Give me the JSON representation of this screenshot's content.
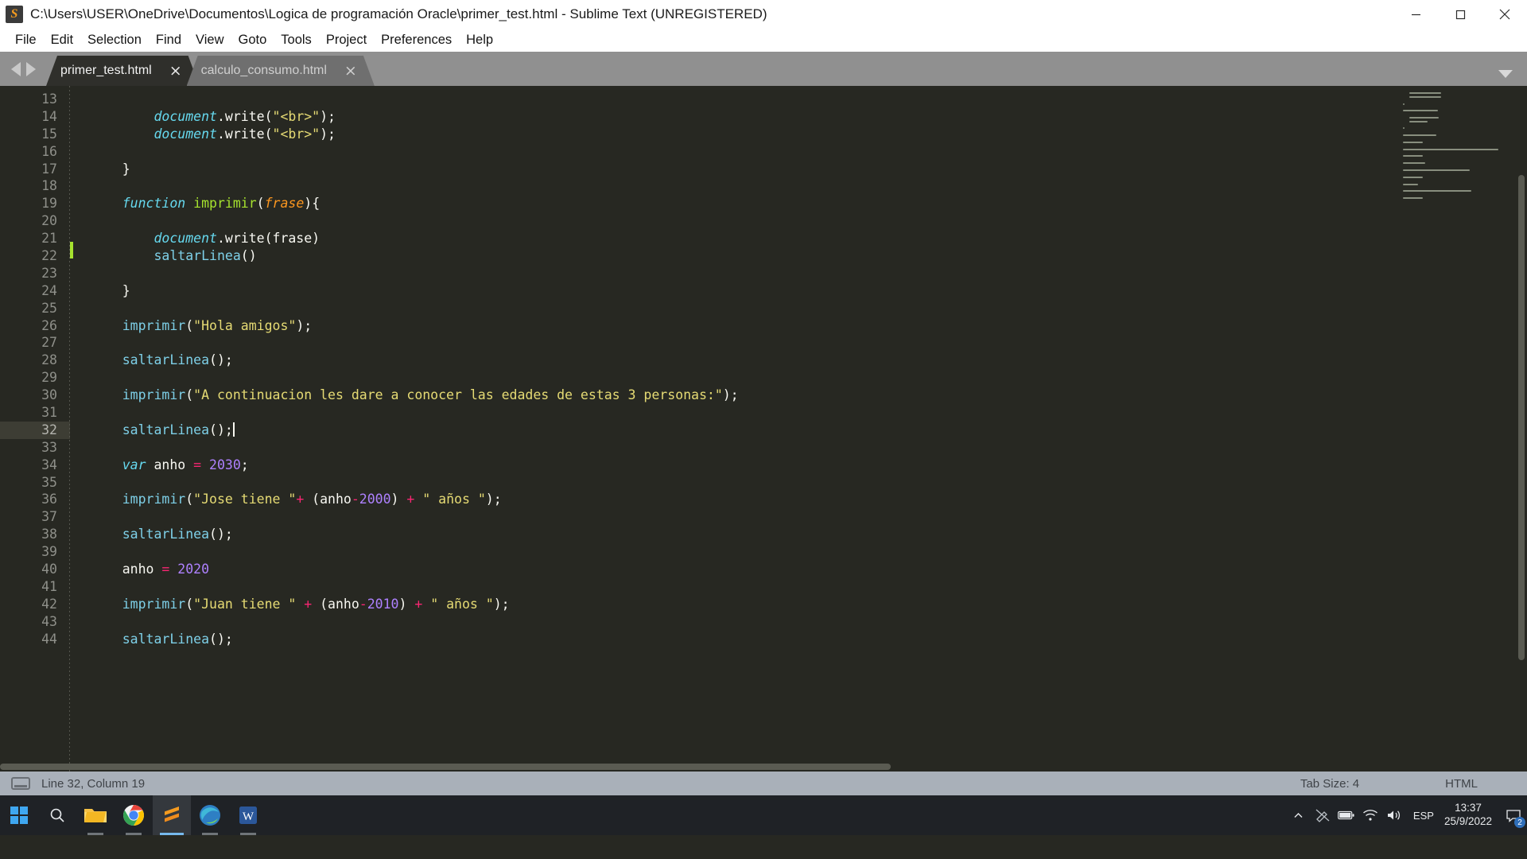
{
  "window": {
    "title": "C:\\Users\\USER\\OneDrive\\Documentos\\Logica de programación Oracle\\primer_test.html - Sublime Text (UNREGISTERED)",
    "app_icon": "sublime-text-icon",
    "controls": {
      "minimize": "minimize-icon",
      "maximize": "maximize-icon",
      "close": "close-icon"
    }
  },
  "menubar": {
    "items": [
      {
        "label": "File"
      },
      {
        "label": "Edit"
      },
      {
        "label": "Selection"
      },
      {
        "label": "Find"
      },
      {
        "label": "View"
      },
      {
        "label": "Goto"
      },
      {
        "label": "Tools"
      },
      {
        "label": "Project"
      },
      {
        "label": "Preferences"
      },
      {
        "label": "Help"
      }
    ]
  },
  "tabs": {
    "items": [
      {
        "label": "primer_test.html",
        "close": "×",
        "active": true
      },
      {
        "label": "calculo_consumo.html",
        "close": "×",
        "active": false
      }
    ],
    "nav_prev": "arrow-left-icon",
    "nav_next": "arrow-right-icon",
    "overflow_menu": "chevron-down-icon"
  },
  "editor": {
    "active_line": 32,
    "first_line": 13,
    "lines": [
      {
        "n": 13,
        "tokens": []
      },
      {
        "n": 14,
        "tokens": [
          {
            "t": "        ",
            "c": "plain"
          },
          {
            "t": "document",
            "c": "kw"
          },
          {
            "t": ".write(",
            "c": "plain"
          },
          {
            "t": "\"<br>\"",
            "c": "str"
          },
          {
            "t": ");",
            "c": "plain"
          }
        ]
      },
      {
        "n": 15,
        "tokens": [
          {
            "t": "        ",
            "c": "plain"
          },
          {
            "t": "document",
            "c": "kw"
          },
          {
            "t": ".write(",
            "c": "plain"
          },
          {
            "t": "\"<br>\"",
            "c": "str"
          },
          {
            "t": ");",
            "c": "plain"
          }
        ]
      },
      {
        "n": 16,
        "tokens": []
      },
      {
        "n": 17,
        "tokens": [
          {
            "t": "    }",
            "c": "plain"
          }
        ]
      },
      {
        "n": 18,
        "tokens": []
      },
      {
        "n": 19,
        "tokens": [
          {
            "t": "    ",
            "c": "plain"
          },
          {
            "t": "function",
            "c": "kw"
          },
          {
            "t": " ",
            "c": "plain"
          },
          {
            "t": "imprimir",
            "c": "fn"
          },
          {
            "t": "(",
            "c": "plain"
          },
          {
            "t": "frase",
            "c": "param"
          },
          {
            "t": "){",
            "c": "plain"
          }
        ]
      },
      {
        "n": 20,
        "tokens": []
      },
      {
        "n": 21,
        "tokens": [
          {
            "t": "        ",
            "c": "plain"
          },
          {
            "t": "document",
            "c": "kw"
          },
          {
            "t": ".write(frase)",
            "c": "plain"
          }
        ]
      },
      {
        "n": 22,
        "tokens": [
          {
            "t": "        ",
            "c": "plain"
          },
          {
            "t": "saltarLinea",
            "c": "call"
          },
          {
            "t": "()",
            "c": "plain"
          }
        ]
      },
      {
        "n": 23,
        "tokens": []
      },
      {
        "n": 24,
        "tokens": [
          {
            "t": "    }",
            "c": "plain"
          }
        ]
      },
      {
        "n": 25,
        "tokens": []
      },
      {
        "n": 26,
        "tokens": [
          {
            "t": "    ",
            "c": "plain"
          },
          {
            "t": "imprimir",
            "c": "call"
          },
          {
            "t": "(",
            "c": "plain"
          },
          {
            "t": "\"Hola amigos\"",
            "c": "str"
          },
          {
            "t": ");",
            "c": "plain"
          }
        ]
      },
      {
        "n": 27,
        "tokens": []
      },
      {
        "n": 28,
        "tokens": [
          {
            "t": "    ",
            "c": "plain"
          },
          {
            "t": "saltarLinea",
            "c": "call"
          },
          {
            "t": "();",
            "c": "plain"
          }
        ]
      },
      {
        "n": 29,
        "tokens": []
      },
      {
        "n": 30,
        "tokens": [
          {
            "t": "    ",
            "c": "plain"
          },
          {
            "t": "imprimir",
            "c": "call"
          },
          {
            "t": "(",
            "c": "plain"
          },
          {
            "t": "\"A continuacion les dare a conocer las edades de estas 3 personas:\"",
            "c": "str"
          },
          {
            "t": ");",
            "c": "plain"
          }
        ]
      },
      {
        "n": 31,
        "tokens": []
      },
      {
        "n": 32,
        "tokens": [
          {
            "t": "    ",
            "c": "plain"
          },
          {
            "t": "saltarLinea",
            "c": "call"
          },
          {
            "t": "();",
            "c": "plain"
          }
        ],
        "caret": true
      },
      {
        "n": 33,
        "tokens": []
      },
      {
        "n": 34,
        "tokens": [
          {
            "t": "    ",
            "c": "plain"
          },
          {
            "t": "var",
            "c": "kw"
          },
          {
            "t": " anho ",
            "c": "plain"
          },
          {
            "t": "=",
            "c": "op"
          },
          {
            "t": " ",
            "c": "plain"
          },
          {
            "t": "2030",
            "c": "num"
          },
          {
            "t": ";",
            "c": "plain"
          }
        ]
      },
      {
        "n": 35,
        "tokens": []
      },
      {
        "n": 36,
        "tokens": [
          {
            "t": "    ",
            "c": "plain"
          },
          {
            "t": "imprimir",
            "c": "call"
          },
          {
            "t": "(",
            "c": "plain"
          },
          {
            "t": "\"Jose tiene \"",
            "c": "str"
          },
          {
            "t": "+",
            "c": "op"
          },
          {
            "t": " (anho",
            "c": "plain"
          },
          {
            "t": "-",
            "c": "op"
          },
          {
            "t": "2000",
            "c": "num"
          },
          {
            "t": ") ",
            "c": "plain"
          },
          {
            "t": "+",
            "c": "op"
          },
          {
            "t": " ",
            "c": "plain"
          },
          {
            "t": "\" años \"",
            "c": "str"
          },
          {
            "t": ");",
            "c": "plain"
          }
        ]
      },
      {
        "n": 37,
        "tokens": []
      },
      {
        "n": 38,
        "tokens": [
          {
            "t": "    ",
            "c": "plain"
          },
          {
            "t": "saltarLinea",
            "c": "call"
          },
          {
            "t": "();",
            "c": "plain"
          }
        ]
      },
      {
        "n": 39,
        "tokens": []
      },
      {
        "n": 40,
        "tokens": [
          {
            "t": "    anho ",
            "c": "plain"
          },
          {
            "t": "=",
            "c": "op"
          },
          {
            "t": " ",
            "c": "plain"
          },
          {
            "t": "2020",
            "c": "num"
          }
        ]
      },
      {
        "n": 41,
        "tokens": []
      },
      {
        "n": 42,
        "tokens": [
          {
            "t": "    ",
            "c": "plain"
          },
          {
            "t": "imprimir",
            "c": "call"
          },
          {
            "t": "(",
            "c": "plain"
          },
          {
            "t": "\"Juan tiene \"",
            "c": "str"
          },
          {
            "t": " ",
            "c": "plain"
          },
          {
            "t": "+",
            "c": "op"
          },
          {
            "t": " (anho",
            "c": "plain"
          },
          {
            "t": "-",
            "c": "op"
          },
          {
            "t": "2010",
            "c": "num"
          },
          {
            "t": ") ",
            "c": "plain"
          },
          {
            "t": "+",
            "c": "op"
          },
          {
            "t": " ",
            "c": "plain"
          },
          {
            "t": "\" años \"",
            "c": "str"
          },
          {
            "t": ");",
            "c": "plain"
          }
        ]
      },
      {
        "n": 43,
        "tokens": []
      },
      {
        "n": 44,
        "tokens": [
          {
            "t": "    ",
            "c": "plain"
          },
          {
            "t": "saltarLinea",
            "c": "call"
          },
          {
            "t": "();",
            "c": "plain"
          }
        ]
      }
    ]
  },
  "statusbar": {
    "encoding_icon": "line-endings-icon",
    "cursor_position": "Line 32, Column 19",
    "tab_size": "Tab Size: 4",
    "syntax": "HTML"
  },
  "taskbar": {
    "start": "windows-start-icon",
    "search": "search-icon",
    "apps": [
      {
        "name": "file-explorer-icon",
        "label": "File Explorer"
      },
      {
        "name": "google-chrome-icon",
        "label": "Google Chrome"
      },
      {
        "name": "sublime-text-icon",
        "label": "Sublime Text"
      },
      {
        "name": "microsoft-edge-icon",
        "label": "Microsoft Edge"
      },
      {
        "name": "microsoft-word-icon",
        "label": "Microsoft Word"
      }
    ],
    "tray": {
      "overflow": "chevron-up-icon",
      "pen": "pen-icon",
      "battery": "battery-icon",
      "network": "wifi-icon",
      "volume": "volume-icon",
      "language": "ESP",
      "time": "13:37",
      "date": "25/9/2022",
      "notifications": "2"
    }
  },
  "colors": {
    "editor_bg": "#272822",
    "accent_string": "#e6db74",
    "accent_keyword": "#66d9ef",
    "accent_operator": "#f92672",
    "accent_number": "#ae81ff",
    "accent_function": "#a6e22e",
    "statusbar_bg": "#a9b0b9",
    "taskbar_bg": "#1f2226"
  }
}
